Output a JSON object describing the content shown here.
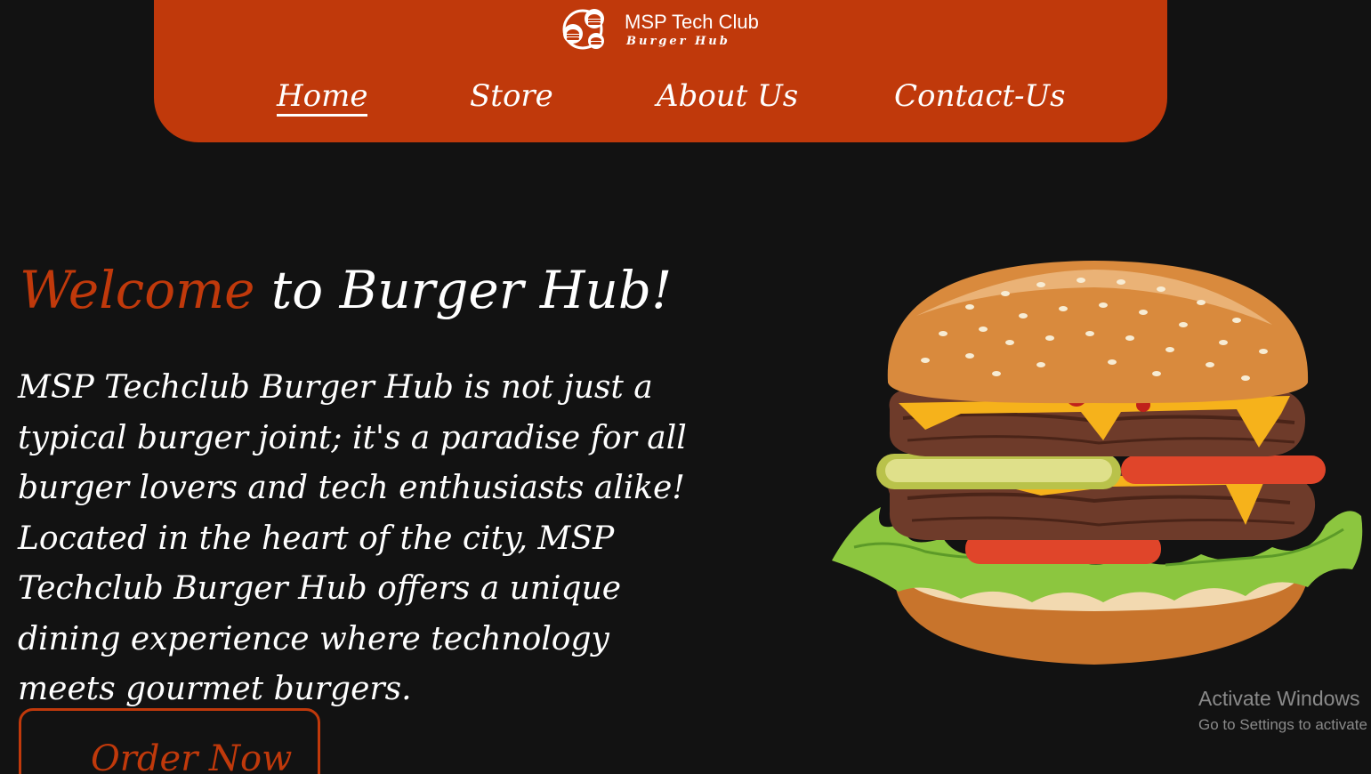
{
  "header": {
    "logo_title": "MSP Tech Club",
    "logo_subtitle": "Burger Hub",
    "logo_icon": "burger-logo-icon",
    "background_color": "#c0390b"
  },
  "nav": {
    "items": [
      {
        "label": "Home",
        "active": true
      },
      {
        "label": "Store",
        "active": false
      },
      {
        "label": "About Us",
        "active": false
      },
      {
        "label": "Contact-Us",
        "active": false
      }
    ]
  },
  "hero": {
    "title_accent": "Welcome",
    "title_rest": " to Burger Hub!",
    "description": "MSP Techclub Burger Hub is not just a typical burger joint; it's a paradise for all burger lovers and tech enthusiasts alike! Located in the heart of the city, MSP Techclub Burger Hub offers a unique dining experience where technology meets gourmet burgers.",
    "cta_label": "Order Now",
    "accent_color": "#c0390b"
  },
  "watermark": {
    "title": "Activate Windows",
    "subtitle": "Go to Settings to activate"
  },
  "colors": {
    "page_background": "#121212",
    "text": "#ffffff"
  }
}
